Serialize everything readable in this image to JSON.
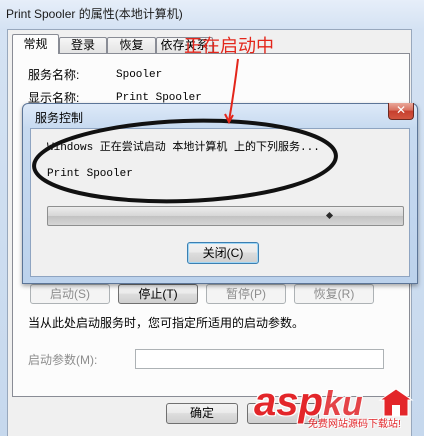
{
  "window": {
    "title": "Print Spooler 的属性(本地计算机)"
  },
  "tabs": [
    {
      "label": "常规",
      "selected": true
    },
    {
      "label": "登录",
      "selected": false
    },
    {
      "label": "恢复",
      "selected": false
    },
    {
      "label": "依存关系",
      "selected": false
    }
  ],
  "general": {
    "service_name_label": "服务名称:",
    "service_name_value": "Spooler",
    "display_name_label": "显示名称:",
    "display_name_value": "Print Spooler",
    "service_buttons": [
      {
        "label": "启动(S)",
        "enabled": false
      },
      {
        "label": "停止(T)",
        "enabled": true
      },
      {
        "label": "暂停(P)",
        "enabled": false
      },
      {
        "label": "恢复(R)",
        "enabled": false
      }
    ],
    "hint": "当从此处启动服务时，您可指定所适用的启动参数。",
    "start_params_label": "启动参数(M):"
  },
  "footer": {
    "ok_label": "确定"
  },
  "service_control_dialog": {
    "title": "服务控制",
    "message": "Windows 正在尝试启动 本地计算机 上的下列服务...",
    "service_name": "Print Spooler",
    "close_label": "关闭(C)",
    "close_icon": "close-icon",
    "progress_marker_icon": "diamond-icon"
  },
  "annotation": {
    "text": "正在启动中",
    "color": "#e3261b",
    "ellipse_color": "#111111"
  },
  "watermark": {
    "brand_main": "asp",
    "brand_accent": "ku",
    "tagline": "免费网站源码下载站!",
    "color": "#e3262a",
    "glyph_icon": "watermark-logo-icon"
  }
}
